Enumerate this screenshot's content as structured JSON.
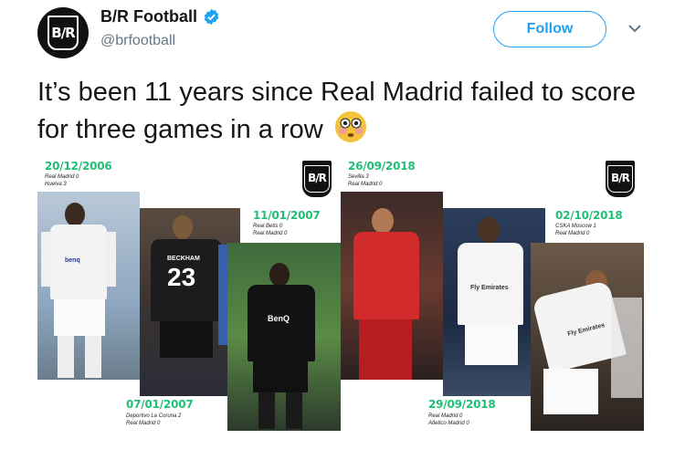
{
  "account": {
    "display_name": "B/R Football",
    "handle": "@brfootball",
    "avatar_text": "B/R",
    "verified_icon": "verified-badge-icon"
  },
  "actions": {
    "follow_label": "Follow",
    "menu_icon": "chevron-down-icon"
  },
  "tweet": {
    "text": "It’s been 11 years since Real Madrid failed to score for three games in a row",
    "emoji": "flushed-face-icon"
  },
  "graphic": {
    "logo_text": "B/R",
    "games": [
      {
        "date": "20/12/2006",
        "line1": "Real Madrid 0",
        "line2": "Huelva 3"
      },
      {
        "date": "07/01/2007",
        "line1": "Deportivo La Coruna 2",
        "line2": "Real Madrid 0"
      },
      {
        "date": "11/01/2007",
        "line1": "Real Betis 0",
        "line2": "Real Madrid 0"
      },
      {
        "date": "26/09/2018",
        "line1": "Sevilla 3",
        "line2": "Real Madrid 0"
      },
      {
        "date": "29/09/2018",
        "line1": "Real Madrid 0",
        "line2": "Atletico Madrid 0"
      },
      {
        "date": "02/10/2018",
        "line1": "CSKA Moscow 1",
        "line2": "Real Madrid 0"
      }
    ],
    "shirt_texts": [
      "benq",
      "BECKHAM",
      "23",
      "BenQ",
      "Fly Emirates",
      "Fly Emirates"
    ]
  },
  "colors": {
    "accent": "#1da1f2",
    "date_green": "#1fbf76",
    "text": "#14171a",
    "muted": "#657786"
  }
}
